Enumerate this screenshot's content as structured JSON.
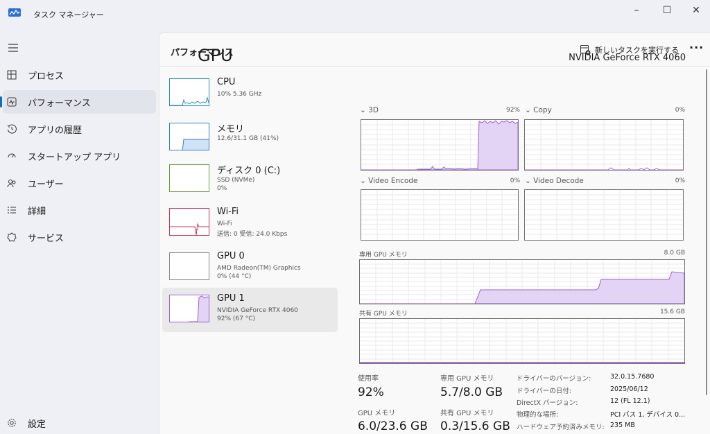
{
  "titlebar": {
    "title": "タスク マネージャー",
    "minimize": "–",
    "maximize": "☐",
    "close": "✕"
  },
  "nav": {
    "items": [
      {
        "label": "プロセス",
        "icon": "processes-icon"
      },
      {
        "label": "パフォーマンス",
        "icon": "performance-icon"
      },
      {
        "label": "アプリの履歴",
        "icon": "history-icon"
      },
      {
        "label": "スタートアップ アプリ",
        "icon": "startup-icon"
      },
      {
        "label": "ユーザー",
        "icon": "users-icon"
      },
      {
        "label": "詳細",
        "icon": "details-icon"
      },
      {
        "label": "サービス",
        "icon": "services-icon"
      }
    ],
    "settings": "設定"
  },
  "header": {
    "title": "パフォーマンス",
    "run_task": "新しいタスクを実行する",
    "more": "···"
  },
  "devices": [
    {
      "name": "CPU",
      "line1": "10% 5.36 GHz",
      "line2": "",
      "line3": ""
    },
    {
      "name": "メモリ",
      "line1": "12.6/31.1 GB (41%)",
      "line2": "",
      "line3": ""
    },
    {
      "name": "ディスク 0 (C:)",
      "line1": "SSD (NVMe)",
      "line2": "0%",
      "line3": ""
    },
    {
      "name": "Wi-Fi",
      "line1": "Wi-Fi",
      "line2": "送信: 0 受信: 24.0 Kbps",
      "line3": ""
    },
    {
      "name": "GPU 0",
      "line1": "AMD Radeon(TM) Graphics",
      "line2": "0% (44 °C)",
      "line3": ""
    },
    {
      "name": "GPU 1",
      "line1": "NVIDIA GeForce RTX 4060",
      "line2": "92% (67 °C)",
      "line3": ""
    }
  ],
  "detail": {
    "title": "GPU",
    "model": "NVIDIA GeForce RTX 4060",
    "graphs": {
      "g3d": {
        "label": "3D",
        "pct": "92%"
      },
      "copy": {
        "label": "Copy",
        "pct": "0%"
      },
      "venc": {
        "label": "Video Encode",
        "pct": "0%"
      },
      "vdec": {
        "label": "Video Decode",
        "pct": "0%"
      },
      "dedicated": {
        "label": "専用 GPU メモリ",
        "max": "8.0 GB"
      },
      "shared": {
        "label": "共有 GPU メモリ",
        "max": "15.6 GB"
      }
    },
    "stats": {
      "usage_label": "使用率",
      "usage_value": "92%",
      "dedicated_label": "専用 GPU メモリ",
      "dedicated_value": "5.7/8.0 GB",
      "gpumem_label": "GPU メモリ",
      "gpumem_value": "6.0/23.6 GB",
      "shared_label": "共有 GPU メモリ",
      "shared_value": "0.3/15.6 GB"
    },
    "info": [
      {
        "label": "ドライバーのバージョン:",
        "value": "32.0.15.7680"
      },
      {
        "label": "ドライバーの日付:",
        "value": "2025/06/12"
      },
      {
        "label": "DirectX バージョン:",
        "value": "12 (FL 12.1)"
      },
      {
        "label": "物理的な場所:",
        "value": "PCI バス 1, デバイス 0..."
      },
      {
        "label": "ハードウェア予約済みメモリ:",
        "value": "235 MB"
      }
    ]
  },
  "colors": {
    "accent": "#0e6fbf",
    "gpu_line": "#9a5fd6",
    "gpu_fill": "#e3d3f5",
    "cpu_line": "#2a8fb5",
    "mem_fill": "#cfe3f8",
    "mem_line": "#3a7bc8",
    "wifi_line": "#c0395a"
  }
}
